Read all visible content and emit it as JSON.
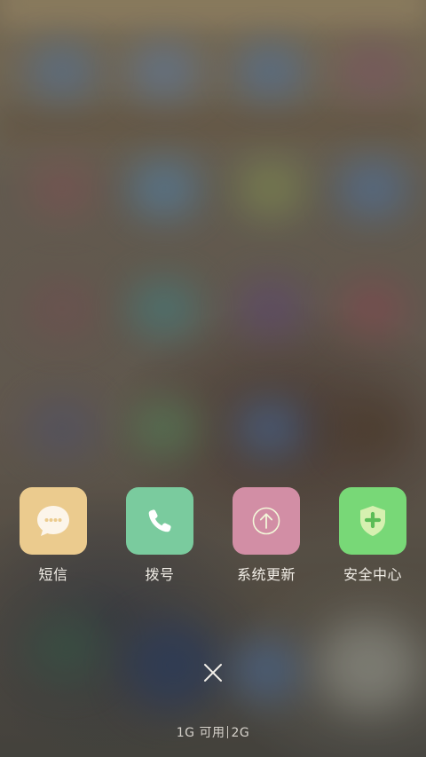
{
  "shortcuts": [
    {
      "label": "短信",
      "icon": "message-bubble-icon",
      "color": "#ebcb8e"
    },
    {
      "label": "拨号",
      "icon": "phone-icon",
      "color": "#7acb9e"
    },
    {
      "label": "系统更新",
      "icon": "upload-arrow-icon",
      "color": "#d28ea5"
    },
    {
      "label": "安全中心",
      "icon": "shield-plus-icon",
      "color": "#78d877"
    }
  ],
  "close": {
    "icon": "close-icon"
  },
  "memory": {
    "available": "1G 可用",
    "total": "2G"
  }
}
